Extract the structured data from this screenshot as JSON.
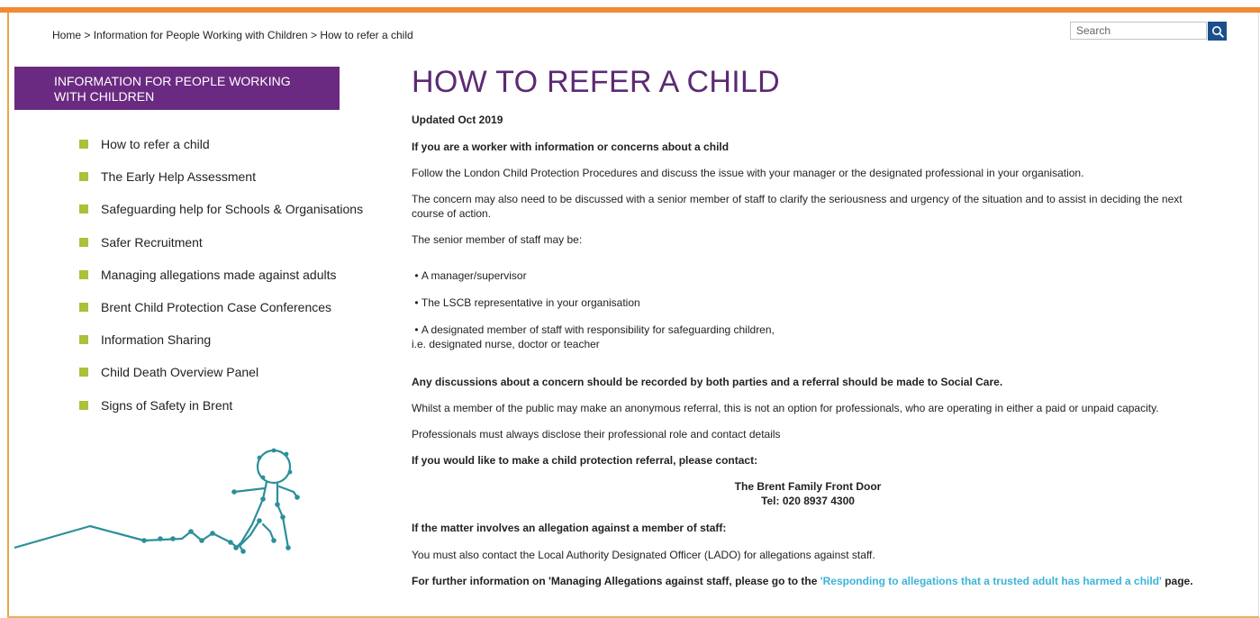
{
  "breadcrumb": {
    "home": "Home",
    "sep": ">",
    "section": "Information for People Working with Children",
    "current": "How to refer a child"
  },
  "search": {
    "placeholder": "Search",
    "icon": "search-icon"
  },
  "sidebar": {
    "heading": "INFORMATION FOR PEOPLE WORKING WITH CHILDREN",
    "items": [
      "How to refer a child",
      "The Early Help Assessment",
      "Safeguarding help for Schools & Organisations",
      "Safer Recruitment",
      "Managing allegations made against adults",
      "Brent Child Protection Case Conferences",
      "Information Sharing",
      "Child Death Overview Panel",
      "Signs of Safety in Brent"
    ]
  },
  "main": {
    "title": "HOW TO REFER A CHILD",
    "updated": "Updated Oct 2019",
    "worker_heading": "If you are a worker with information or concerns about a child",
    "follow": "Follow the London Child Protection Procedures and discuss the issue with your manager or the designated professional in your organisation.",
    "concern_line1": "The concern may also need to be discussed with a senior member of staff to clarify the seriousness and urgency of the situation and to assist in deciding the next",
    "concern_line2": "course of action.",
    "senior": "The senior member of staff may be:",
    "bullets": [
      "A manager/supervisor",
      "The LSCB representative in your organisation",
      "A designated member of staff with responsibility for safeguarding children,"
    ],
    "bullet3_cont": "i.e. designated nurse, doctor or teacher",
    "discussions": "Any discussions about a concern should be recorded by both parties and a referral should be made to Social Care.",
    "whilst": "Whilst a member of the public may make an anonymous referral, this is not an option for professionals, who are operating in either a paid or unpaid capacity.",
    "professionals": "Professionals must always disclose their professional role and contact details",
    "referral_heading": "If you would like to make a child protection referral, please contact:",
    "front_door": "The Brent Family Front Door",
    "tel": "Tel: 020 8937 4300",
    "allegation_heading": "If the matter involves an allegation against a member of staff:",
    "lado": "You must also contact the Local Authority Designated Officer (LADO) for allegations against staff.",
    "further_pre": "For further information on 'Managing Allegations against staff, please go to the",
    "further_link": "'Responding to allegations that a trusted adult has harmed a child'",
    "further_post": "page."
  },
  "colors": {
    "accent_orange": "#f08a34",
    "brand_purple": "#6b2a82",
    "title_purple": "#5c2a73",
    "bullet_green": "#a8c23a",
    "link_blue": "#3bb4d8",
    "search_button": "#1b4f8c",
    "figure_teal": "#2b8f9a"
  }
}
